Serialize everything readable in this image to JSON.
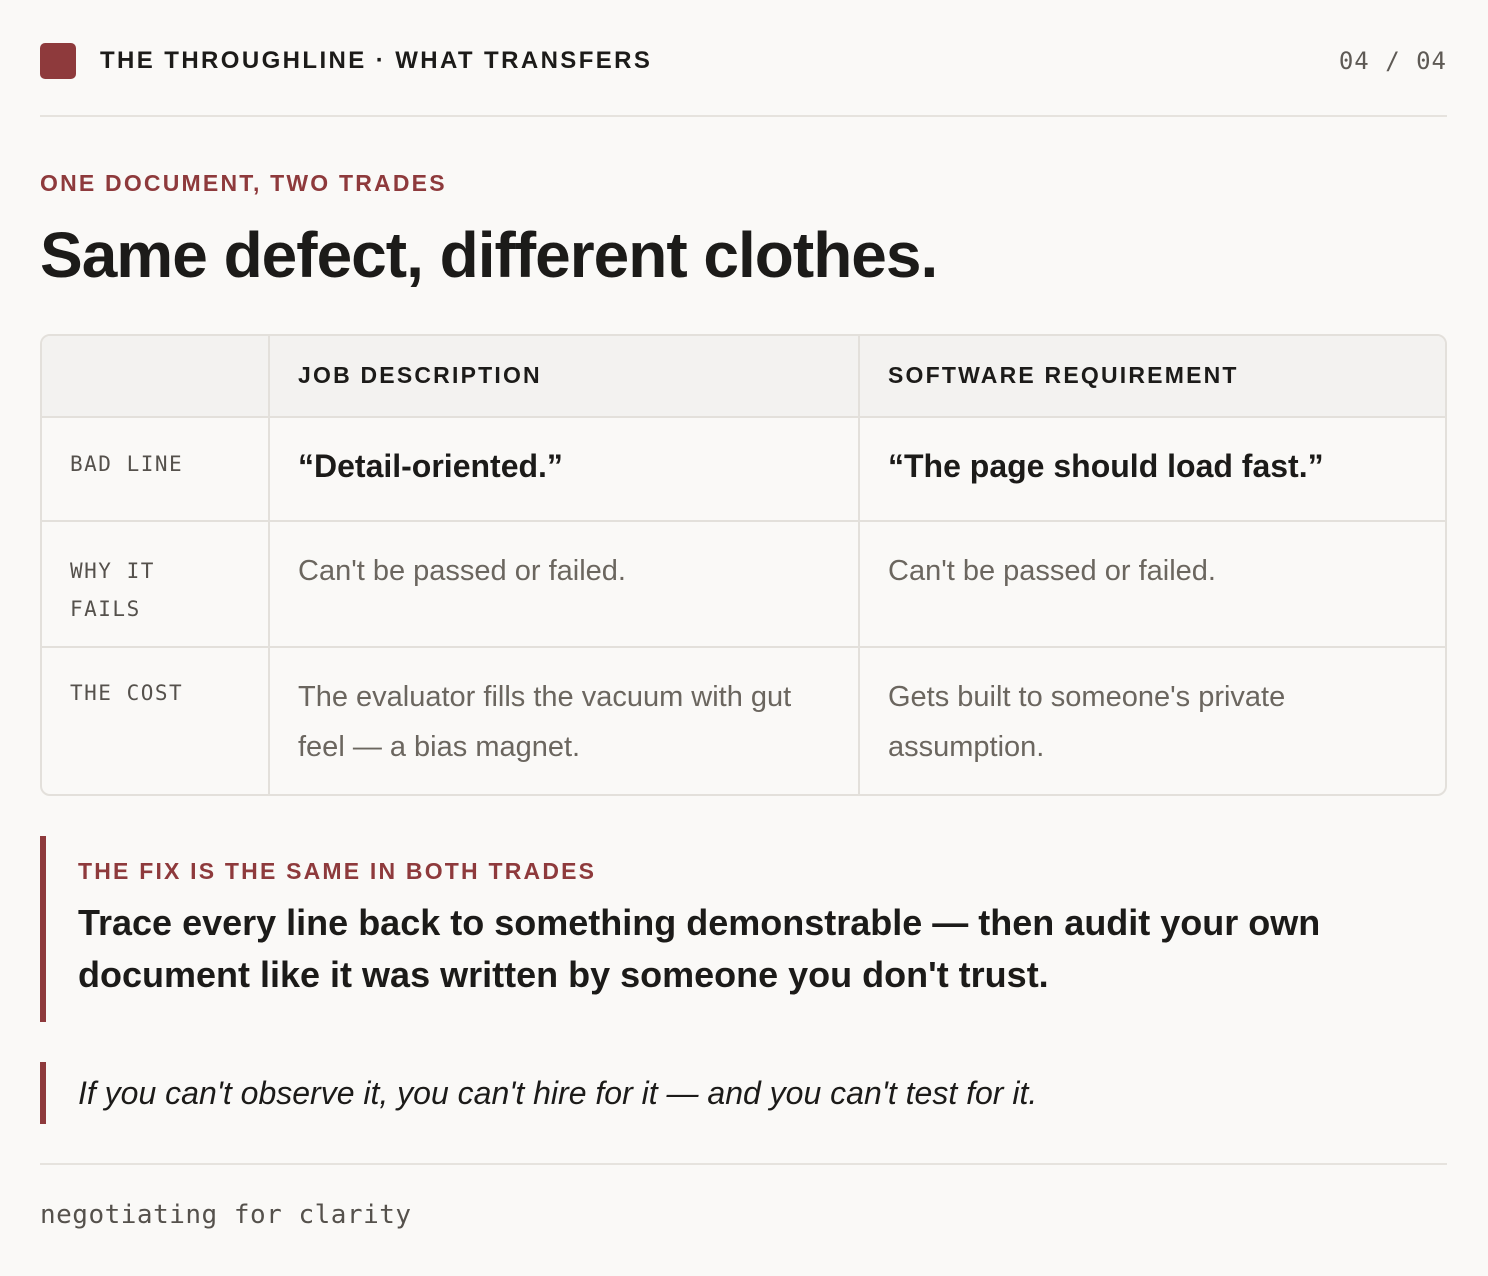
{
  "header": {
    "title": "THE THROUGHLINE · WHAT TRANSFERS",
    "page_indicator": "04 / 04",
    "brand_color": "#8e3a3c"
  },
  "section": {
    "eyebrow": "ONE DOCUMENT, TWO TRADES",
    "headline": "Same defect, different clothes."
  },
  "table": {
    "columns": [
      "",
      "JOB DESCRIPTION",
      "SOFTWARE REQUIREMENT"
    ],
    "rows": [
      {
        "label": "BAD LINE",
        "job": "“Detail-oriented.”",
        "software": "“The page should load fast.”"
      },
      {
        "label": "WHY IT FAILS",
        "job": "Can't be passed or failed.",
        "software": "Can't be passed or failed."
      },
      {
        "label": "THE COST",
        "job": "The evaluator fills the vacuum with gut feel — a bias magnet.",
        "software": "Gets built to someone's private assumption."
      }
    ]
  },
  "callout": {
    "label": "THE FIX IS THE SAME IN BOTH TRADES",
    "text": "Trace every line back to something demonstrable — then audit your own document like it was written by someone you don't trust."
  },
  "pullquote": {
    "text": "If you can't observe it, you can't hire for it — and you can't test for it."
  },
  "footer": {
    "text": "negotiating for clarity"
  }
}
